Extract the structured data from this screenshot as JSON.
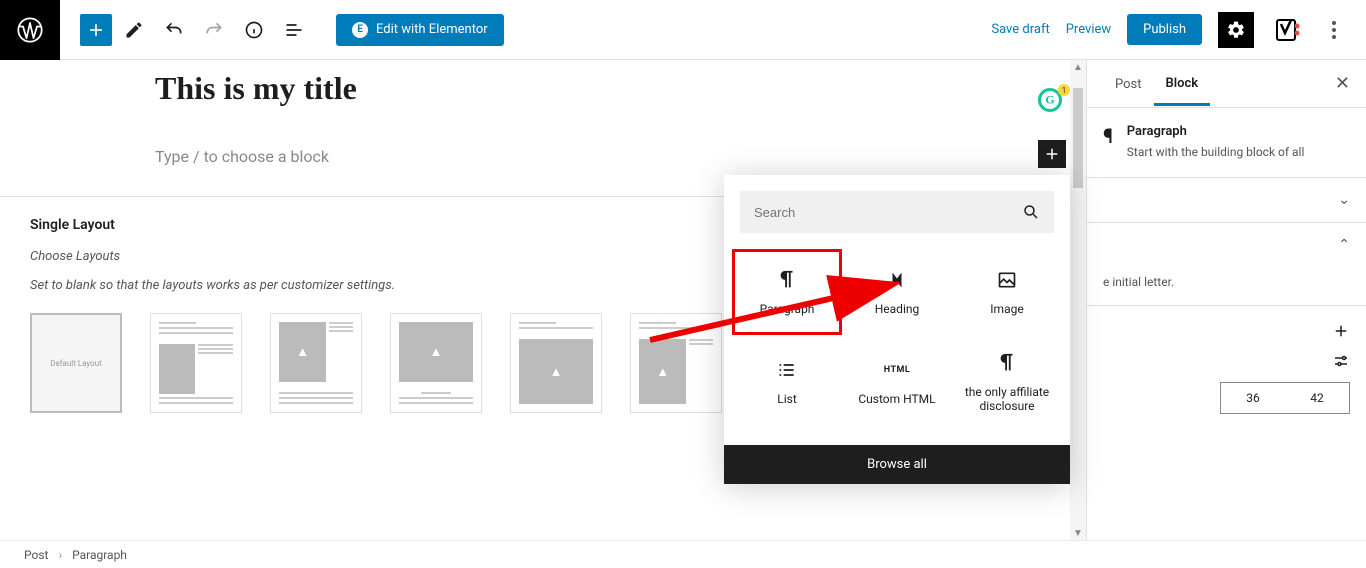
{
  "toolbar": {
    "elementor_label": "Edit with Elementor",
    "save_draft": "Save draft",
    "preview": "Preview",
    "publish": "Publish"
  },
  "editor": {
    "title": "This is my title",
    "prompt": "Type / to choose a block"
  },
  "grammarly": {
    "badge": "1"
  },
  "layout": {
    "heading": "Single Layout",
    "choose": "Choose Layouts",
    "hint": "Set to blank so that the layouts works as per customizer settings.",
    "default_label": "Default Layout"
  },
  "inserter": {
    "search_placeholder": "Search",
    "blocks": [
      {
        "id": "paragraph",
        "label": "Paragraph"
      },
      {
        "id": "heading",
        "label": "Heading"
      },
      {
        "id": "image",
        "label": "Image"
      },
      {
        "id": "list",
        "label": "List"
      },
      {
        "id": "custom-html",
        "label": "Custom HTML"
      },
      {
        "id": "affiliate",
        "label": "the only affiliate disclosure"
      }
    ],
    "browse_all": "Browse all"
  },
  "sidebar": {
    "tabs": {
      "post": "Post",
      "block": "Block"
    },
    "block_name": "Paragraph",
    "block_desc": "Start with the building block of all",
    "initial_letter_text": "e initial letter.",
    "num_a": "36",
    "num_b": "42"
  },
  "footer": {
    "crumb1": "Post",
    "crumb2": "Paragraph"
  }
}
